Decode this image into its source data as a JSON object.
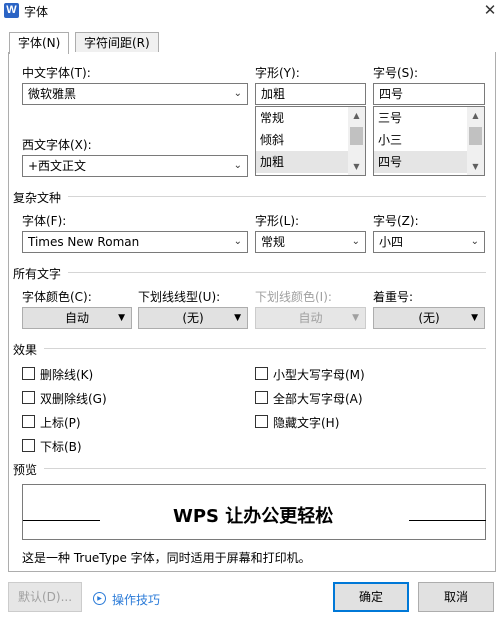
{
  "window": {
    "title": "字体",
    "icon_letter": "W",
    "close_glyph": "✕"
  },
  "tabs": [
    {
      "label": "字体(N)"
    },
    {
      "label": "字符间距(R)"
    }
  ],
  "chinese_font": {
    "label": "中文字体(T):",
    "value": "微软雅黑"
  },
  "western_font": {
    "label": "西文字体(X):",
    "value": "+西文正文"
  },
  "font_style": {
    "label": "字形(Y):",
    "value": "加粗",
    "options": [
      "常规",
      "倾斜",
      "加粗"
    ],
    "selected": "加粗"
  },
  "font_size": {
    "label": "字号(S):",
    "value": "四号",
    "options": [
      "三号",
      "小三",
      "四号"
    ],
    "selected": "四号"
  },
  "complex_script": {
    "section_label": "复杂文种",
    "font_label": "字体(F):",
    "font_value": "Times New Roman",
    "style_label": "字形(L):",
    "style_value": "常规",
    "size_label": "字号(Z):",
    "size_value": "小四"
  },
  "all_text": {
    "section_label": "所有文字",
    "font_color_label": "字体颜色(C):",
    "font_color_value": "自动",
    "underline_type_label": "下划线线型(U):",
    "underline_type_value": "(无)",
    "underline_color_label": "下划线颜色(I):",
    "underline_color_value": "自动",
    "emphasis_label": "着重号:",
    "emphasis_value": "(无)"
  },
  "effects": {
    "section_label": "效果",
    "items": [
      {
        "label": "删除线(K)",
        "checked": false
      },
      {
        "label": "双删除线(G)",
        "checked": false
      },
      {
        "label": "上标(P)",
        "checked": false
      },
      {
        "label": "下标(B)",
        "checked": false
      },
      {
        "label": "小型大写字母(M)",
        "checked": false
      },
      {
        "label": "全部大写字母(A)",
        "checked": false
      },
      {
        "label": "隐藏文字(H)",
        "checked": false
      }
    ]
  },
  "preview": {
    "section_label": "预览",
    "sample_text": "WPS 让办公更轻松",
    "description": "这是一种 TrueType 字体，同时适用于屏幕和打印机。"
  },
  "footer": {
    "default_button": "默认(D)...",
    "tips_link": "操作技巧",
    "ok_button": "确定",
    "cancel_button": "取消"
  },
  "colors": {
    "accent": "#0078d7",
    "link": "#2b7bd8",
    "selection": "#e5e5e5",
    "icon_bg": "#2b64c5"
  },
  "icons": {
    "app": "wps-writer-icon",
    "close": "close-icon",
    "tips": "play-circle-icon",
    "dropdown": "chevron-down-icon"
  }
}
